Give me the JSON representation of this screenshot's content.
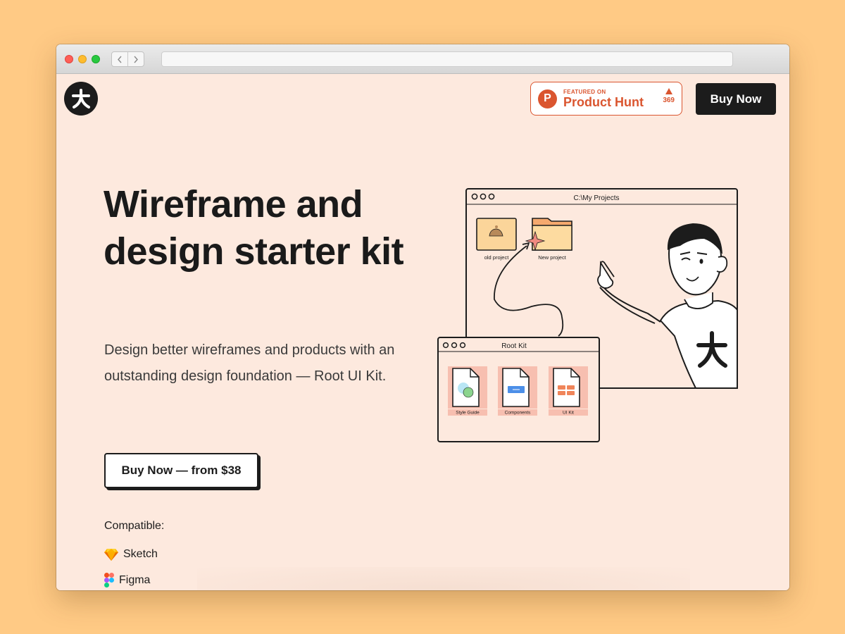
{
  "browser": {
    "back_icon": "chevron-left-icon",
    "forward_icon": "chevron-right-icon",
    "url": ""
  },
  "header": {
    "logo_glyph": "大",
    "product_hunt": {
      "featured_label": "FEATURED ON",
      "name": "Product Hunt",
      "votes": "369",
      "color": "#DA552F"
    },
    "buy_label": "Buy Now"
  },
  "hero": {
    "title": "Wireframe and design starter kit",
    "subtitle": "Design better wireframes and products with an outstanding design foundation — Root UI Kit.",
    "cta_label": "Buy Now — from $38"
  },
  "compatible": {
    "label": "Compatible:",
    "items": [
      {
        "name": "Sketch",
        "icon": "sketch-icon"
      },
      {
        "name": "Figma",
        "icon": "figma-icon"
      }
    ]
  },
  "illustration": {
    "projects_window_title": "C:\\My Projects",
    "folders": [
      "old project",
      "New project"
    ],
    "root_kit_window_title": "Root Kit",
    "files": [
      "Style Guide",
      "Components",
      "UI Kit"
    ],
    "shirt_glyph": "大"
  },
  "colors": {
    "background": "#FFCA85",
    "page": "#FDE9DE",
    "dark": "#1C1C1C",
    "accent": "#DA552F"
  }
}
